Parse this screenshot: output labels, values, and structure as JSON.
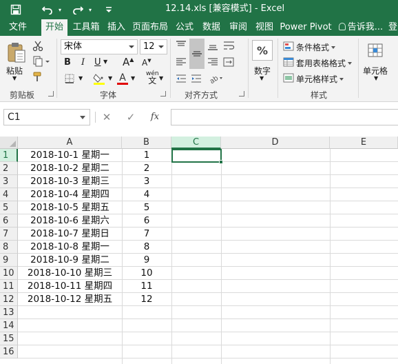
{
  "window": {
    "title": "12.14.xls  [兼容模式] - Excel"
  },
  "quick_access": {
    "save_icon": "save-icon",
    "undo_icon": "undo-icon",
    "redo_icon": "redo-icon",
    "customize_icon": "customize-icon"
  },
  "tabs": [
    {
      "label": "文件"
    },
    {
      "label": "开始"
    },
    {
      "label": "工具箱"
    },
    {
      "label": "插入"
    },
    {
      "label": "页面布局"
    },
    {
      "label": "公式"
    },
    {
      "label": "数据"
    },
    {
      "label": "审阅"
    },
    {
      "label": "视图"
    },
    {
      "label": "Power Pivot"
    },
    {
      "label": "告诉我..."
    },
    {
      "label": "登"
    }
  ],
  "ribbon": {
    "clipboard": {
      "paste_label": "粘贴",
      "group_label": "剪贴板"
    },
    "font": {
      "name": "宋体",
      "size": "12",
      "bold": "B",
      "italic": "I",
      "underline": "U",
      "grow": "A",
      "shrink": "A",
      "fontcolor": "A",
      "wen": "wén",
      "wen_char": "文",
      "group_label": "字体"
    },
    "alignment": {
      "group_label": "对齐方式"
    },
    "number": {
      "label": "数字",
      "percent": "%"
    },
    "styles": {
      "conditional": "条件格式",
      "table": "套用表格格式",
      "cell_styles": "单元格样式",
      "group_label": "样式"
    },
    "cells": {
      "label": "单元格"
    }
  },
  "formula_bar": {
    "name_box": "C1",
    "cancel": "✕",
    "enter": "✓",
    "fx": "fx",
    "value": ""
  },
  "sheet": {
    "columns": [
      "A",
      "B",
      "C",
      "D",
      "E"
    ],
    "selected_column": "C",
    "rows": [
      "1",
      "2",
      "3",
      "4",
      "5",
      "6",
      "7",
      "8",
      "9",
      "10",
      "11",
      "12",
      "13",
      "14",
      "15",
      "16"
    ],
    "data": [
      {
        "a": "2018-10-1 星期一",
        "b": "1"
      },
      {
        "a": "2018-10-2 星期二",
        "b": "2"
      },
      {
        "a": "2018-10-3 星期三",
        "b": "3"
      },
      {
        "a": "2018-10-4 星期四",
        "b": "4"
      },
      {
        "a": "2018-10-5 星期五",
        "b": "5"
      },
      {
        "a": "2018-10-6 星期六",
        "b": "6"
      },
      {
        "a": "2018-10-7 星期日",
        "b": "7"
      },
      {
        "a": "2018-10-8 星期一",
        "b": "8"
      },
      {
        "a": "2018-10-9 星期二",
        "b": "9"
      },
      {
        "a": "2018-10-10 星期三",
        "b": "10"
      },
      {
        "a": "2018-10-11 星期四",
        "b": "11"
      },
      {
        "a": "2018-10-12 星期五",
        "b": "12"
      }
    ]
  },
  "colors": {
    "excel_green": "#217346",
    "ribbon_bg": "#f3f3f3",
    "highlight_yellow": "#ffff00",
    "font_red": "#e00000"
  }
}
